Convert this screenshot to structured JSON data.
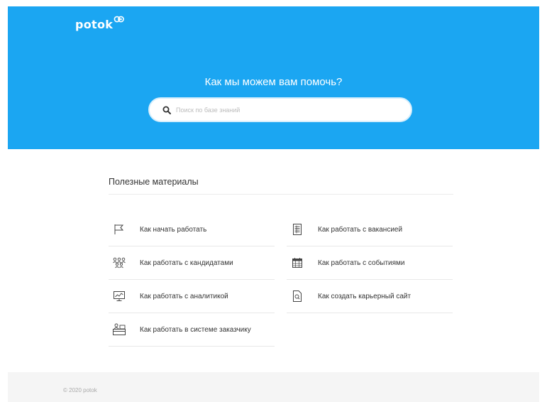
{
  "brand": {
    "logo_text": "potok"
  },
  "hero": {
    "title": "Как мы можем вам помочь?",
    "search_placeholder": "Поиск по базе знаний",
    "search_value": "",
    "background_color": "#1ba6f2"
  },
  "materials": {
    "heading": "Полезные материалы",
    "left": [
      {
        "label": "Как начать работать",
        "icon": "flag-icon"
      },
      {
        "label": "Как работать с кандидатами",
        "icon": "people-icon"
      },
      {
        "label": "Как работать с аналитикой",
        "icon": "chart-monitor-icon"
      },
      {
        "label": "Как работать в системе заказчику",
        "icon": "client-desk-icon"
      }
    ],
    "right": [
      {
        "label": "Как работать с вакансией",
        "icon": "document-list-icon"
      },
      {
        "label": "Как работать с событиями",
        "icon": "calendar-icon"
      },
      {
        "label": "Как создать карьерный сайт",
        "icon": "page-search-icon"
      }
    ]
  },
  "footer": {
    "copyright": "© 2020 potok"
  }
}
